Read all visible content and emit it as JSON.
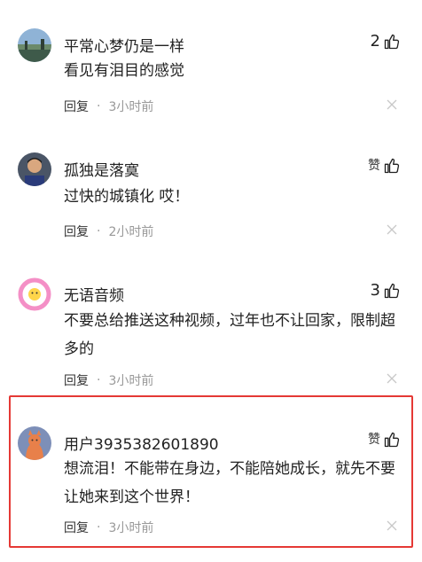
{
  "comments": [
    {
      "username": "平常心梦仍是一样",
      "like_count": "2",
      "like_label": "",
      "content": "看见有泪目的感觉",
      "reply_label": "回复",
      "separator": "·",
      "time": "3小时前"
    },
    {
      "username": "孤独是落寞",
      "like_count": "",
      "like_label": "赞",
      "content": "过快的城镇化 哎！",
      "reply_label": "回复",
      "separator": "·",
      "time": "2小时前"
    },
    {
      "username": "无语音频",
      "like_count": "3",
      "like_label": "",
      "content": "不要总给推送这种视频，过年也不让回家，限制超多的",
      "reply_label": "回复",
      "separator": "·",
      "time": "3小时前"
    },
    {
      "username": "用户3935382601890",
      "like_count": "",
      "like_label": "赞",
      "content": "想流泪！不能带在身边，不能陪她成长，就先不要让她来到这个世界！",
      "reply_label": "回复",
      "separator": "·",
      "time": "3小时前"
    }
  ],
  "colors": {
    "highlight_border": "#e53935",
    "meta_text": "#999999",
    "primary_text": "#222222"
  }
}
